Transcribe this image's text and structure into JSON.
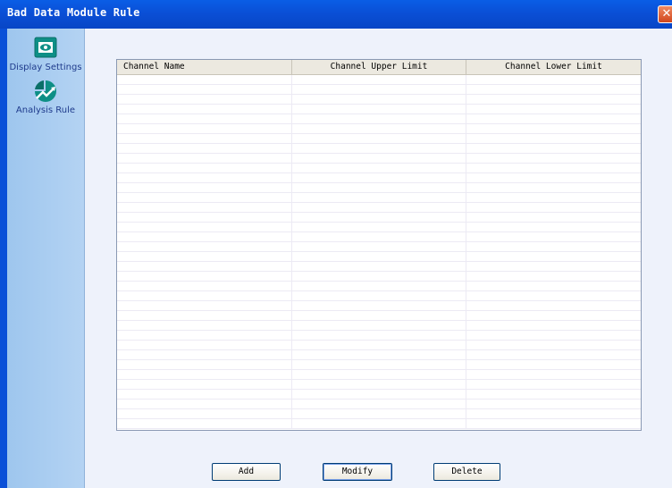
{
  "window": {
    "title": "Bad Data Module Rule",
    "close_glyph": "✕"
  },
  "sidebar": {
    "items": [
      {
        "label": "Display Settings",
        "icon": "eye-icon"
      },
      {
        "label": "Analysis Rule",
        "icon": "chart-arrow-icon"
      }
    ]
  },
  "table": {
    "columns": [
      "Channel Name",
      "Channel Upper Limit",
      "Channel Lower Limit"
    ],
    "rows": []
  },
  "buttons": {
    "add": "Add",
    "modify": "Modify",
    "delete": "Delete"
  },
  "colors": {
    "titlebar": "#0a50d8",
    "sidebar": "#a9cdf1",
    "content": "#eef2fb",
    "icon_teal": "#0e8f86"
  }
}
